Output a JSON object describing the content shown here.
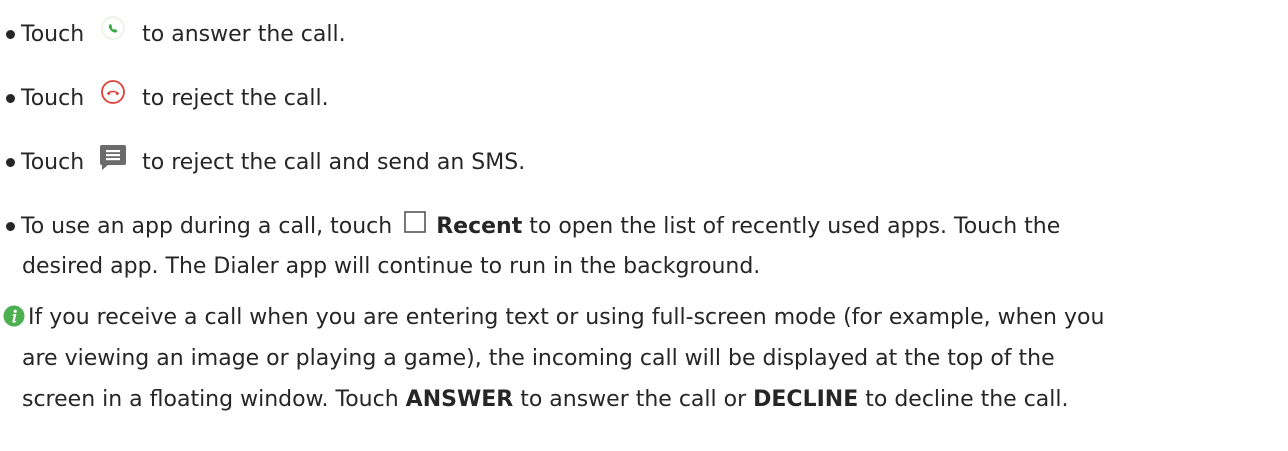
{
  "items": [
    {
      "pre": "Touch",
      "post": "to answer the call.",
      "icon": "answer-call-icon"
    },
    {
      "pre": "Touch",
      "post": "to reject the call.",
      "icon": "reject-call-icon"
    },
    {
      "pre": "Touch",
      "post": "to reject the call and send an SMS.",
      "icon": "message-icon"
    }
  ],
  "recent_item": {
    "pre": "To use an app during a call, touch",
    "icon": "recent-square-icon",
    "bold": "Recent",
    "post": "to open the list of recently used apps. Touch the",
    "line2": "desired app. The Dialer app will continue to run in the background."
  },
  "note": {
    "icon": "info-icon",
    "line1": "If you receive a call when you are entering text or using full-screen mode (for example, when you",
    "line2": "are viewing an image or playing a game), the incoming call will be displayed at the top of the",
    "line3_pre": "screen in a floating window. Touch",
    "line3_bold1": "ANSWER",
    "line3_mid": "to answer the call or",
    "line3_bold2": "DECLINE",
    "line3_post": "to decline the call."
  },
  "colors": {
    "answer_green": "#3aa845",
    "reject_red": "#e0403a",
    "icon_gray": "#6b6b6b",
    "info_green": "#4caf50"
  }
}
